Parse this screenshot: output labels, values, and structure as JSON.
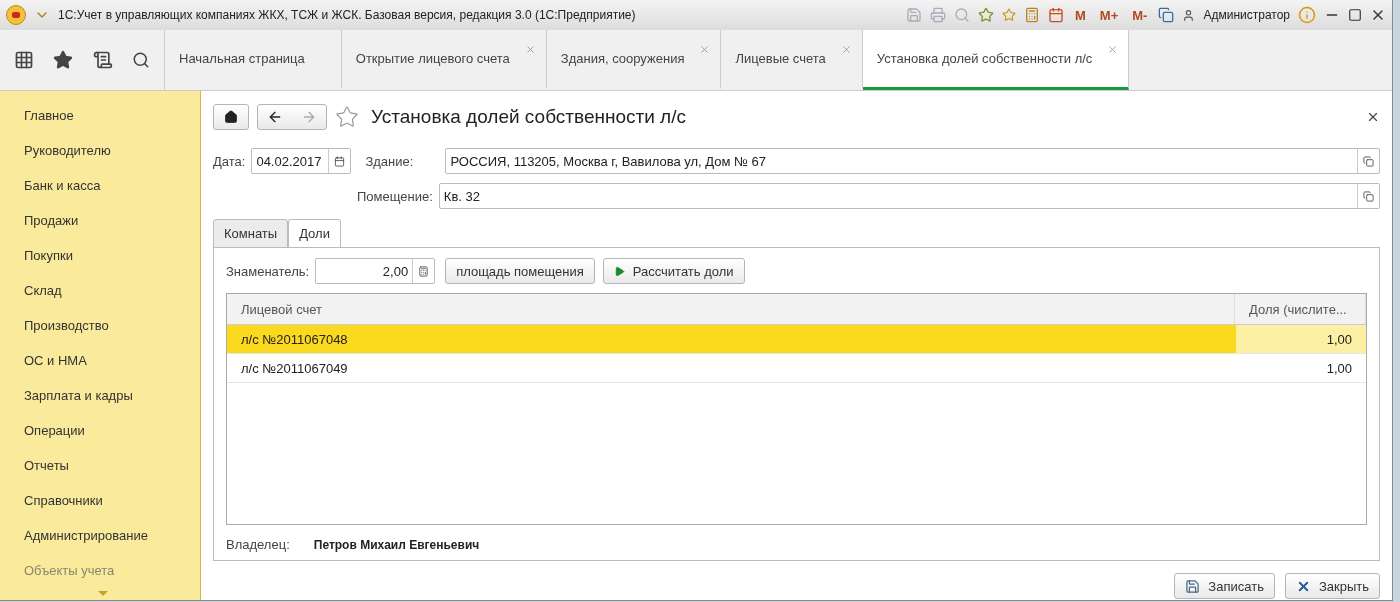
{
  "window": {
    "title": "1С:Учет в управляющих компаниях ЖКХ, ТСЖ и ЖСК. Базовая версия, редакция 3.0  (1С:Предприятие)",
    "memory_buttons": [
      "M",
      "M+",
      "M-"
    ],
    "user": "Администратор"
  },
  "tabs": [
    {
      "label": "Начальная страница",
      "selected": false,
      "closable": false
    },
    {
      "label": "Открытие лицевого счета",
      "selected": false,
      "closable": true
    },
    {
      "label": "Здания, сооружения",
      "selected": false,
      "closable": true
    },
    {
      "label": "Лицевые счета",
      "selected": false,
      "closable": true
    },
    {
      "label": "Установка долей собственности л/с",
      "selected": true,
      "closable": true
    }
  ],
  "sidebar": {
    "items": [
      {
        "label": "Главное",
        "dimmed": false
      },
      {
        "label": "Руководителю",
        "dimmed": false
      },
      {
        "label": "Банк и касса",
        "dimmed": false
      },
      {
        "label": "Продажи",
        "dimmed": false
      },
      {
        "label": "Покупки",
        "dimmed": false
      },
      {
        "label": "Склад",
        "dimmed": false
      },
      {
        "label": "Производство",
        "dimmed": false
      },
      {
        "label": "ОС и НМА",
        "dimmed": false
      },
      {
        "label": "Зарплата и кадры",
        "dimmed": false
      },
      {
        "label": "Операции",
        "dimmed": false
      },
      {
        "label": "Отчеты",
        "dimmed": false
      },
      {
        "label": "Справочники",
        "dimmed": false
      },
      {
        "label": "Администрирование",
        "dimmed": false
      },
      {
        "label": "Объекты учета",
        "dimmed": true
      }
    ]
  },
  "form": {
    "title": "Установка долей собственности л/с",
    "date": {
      "label": "Дата:",
      "value": "04.02.2017"
    },
    "building": {
      "label": "Здание:",
      "value": "РОССИЯ, 113205, Москва г, Вавилова ул, Дом № 67"
    },
    "room": {
      "label": "Помещение:",
      "value": "Кв. 32"
    },
    "inner_tabs": [
      {
        "label": "Комнаты",
        "selected": false
      },
      {
        "label": "Доли",
        "selected": true
      }
    ],
    "denominator": {
      "label": "Знаменатель:",
      "value": "2,00"
    },
    "buttons": [
      "площадь помещения",
      "Рассчитать доли"
    ],
    "table": {
      "columns": [
        "Лицевой счет",
        "Доля (числите..."
      ],
      "rows": [
        {
          "account": "л/с №2011067048",
          "share": "1,00",
          "selected": true
        },
        {
          "account": "л/с №2011067049",
          "share": "1,00",
          "selected": false
        }
      ]
    },
    "owner": {
      "label": "Владелец:",
      "value": "Петров Михаил Евгеньевич"
    },
    "footer_buttons": [
      "Записать",
      "Закрыть"
    ]
  }
}
